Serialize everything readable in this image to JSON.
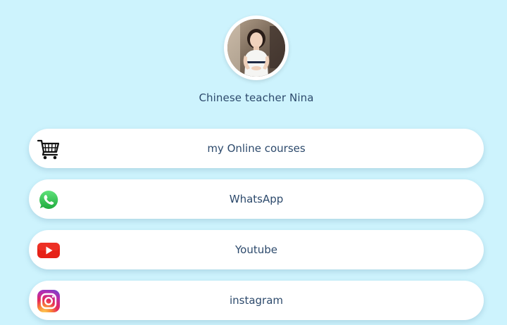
{
  "profile": {
    "name": "Chinese teacher Nina"
  },
  "links": [
    {
      "label": "my Online courses",
      "icon": "shopping-cart-icon"
    },
    {
      "label": "WhatsApp",
      "icon": "whatsapp-icon"
    },
    {
      "label": "Youtube",
      "icon": "youtube-icon"
    },
    {
      "label": "instagram",
      "icon": "instagram-icon"
    }
  ],
  "colors": {
    "background": "#cdf3fd",
    "button": "#ffffff",
    "text": "#2d4a6c",
    "whatsapp": "#25d366",
    "youtube": "#e62117"
  }
}
